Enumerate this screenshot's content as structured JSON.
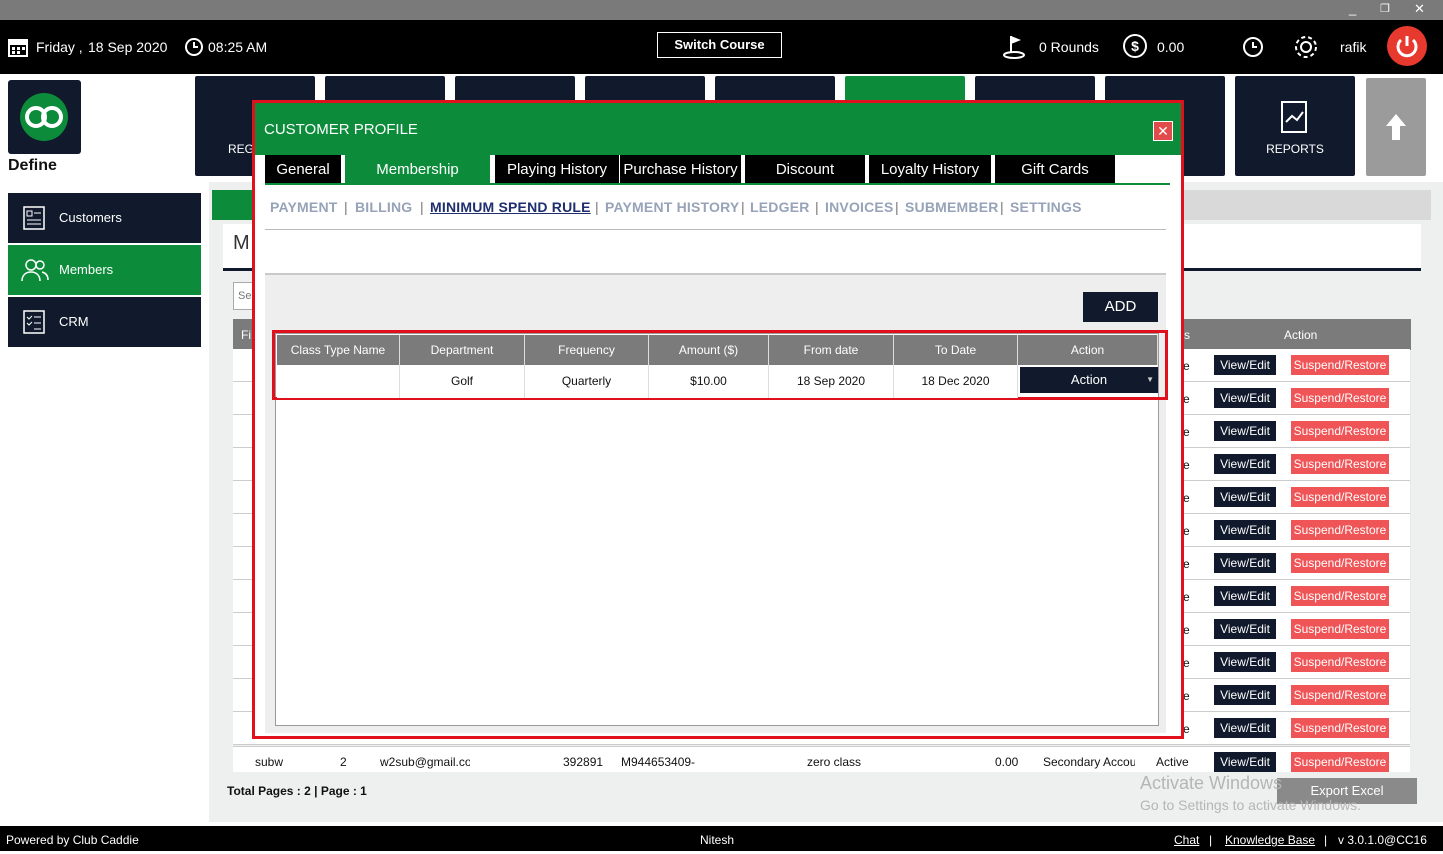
{
  "window": {
    "minimize": "_",
    "maximize": "❐",
    "close": "✕"
  },
  "topbar": {
    "day": "Friday ,",
    "date": "18 Sep 2020",
    "time": "08:25 AM",
    "switch_course": "Switch Course",
    "rounds": "0 Rounds",
    "amount": "0.00",
    "user": "rafik"
  },
  "nav": {
    "define_label": "Define",
    "reg_label": "REG",
    "reports_label": "REPORTS"
  },
  "sidebar": {
    "items": [
      {
        "label": "Customers",
        "icon": "id-card-icon"
      },
      {
        "label": "Members",
        "icon": "users-icon"
      },
      {
        "label": "CRM",
        "icon": "checklist-icon"
      }
    ]
  },
  "background": {
    "heading_fragment": "M",
    "search_fragment": "Se",
    "first_col_fragment": "Fi",
    "action_header": "Action",
    "status_fragment": "s",
    "row_status": "e",
    "view_edit": "View/Edit",
    "suspend_restore": "Suspend/Restore",
    "last_row": {
      "name": "subw",
      "num": "2",
      "email": "w2sub@gmail.co",
      "code": "392891",
      "member_id": "M944653409-",
      "class": "zero class",
      "balance": "0.00",
      "type": "Secondary Accou",
      "status": "Active"
    },
    "total_pages": "Total Pages : 2 | Page : 1",
    "export_excel": "Export Excel"
  },
  "modal": {
    "title": "CUSTOMER PROFILE",
    "close": "✕",
    "tabs": [
      "General",
      "Membership",
      "Playing History",
      "Purchase History",
      "Discount",
      "Loyalty History",
      "Gift Cards"
    ],
    "active_tab": "Membership",
    "subtabs": [
      "PAYMENT",
      "BILLING",
      "MINIMUM SPEND RULE",
      "PAYMENT HISTORY",
      "LEDGER",
      "INVOICES",
      "SUBMEMBER",
      "SETTINGS"
    ],
    "active_subtab": "MINIMUM SPEND RULE",
    "add_button": "ADD",
    "grid": {
      "headers": [
        "Class Type Name",
        "Department",
        "Frequency",
        "Amount ($)",
        "From date",
        "To Date",
        "Action"
      ],
      "row": {
        "class_type": "",
        "department": "Golf",
        "frequency": "Quarterly",
        "amount": "$10.00",
        "from": "18 Sep 2020",
        "to": "18 Dec 2020",
        "action": "Action"
      }
    }
  },
  "watermark": {
    "line1": "Activate Windows",
    "line2": "Go to Settings to activate Windows."
  },
  "footer": {
    "powered": "Powered by Club Caddie",
    "user": "Nitesh",
    "chat": "Chat",
    "kb": "Knowledge Base",
    "version": "v 3.0.1.0@CC16",
    "sep": "|"
  }
}
